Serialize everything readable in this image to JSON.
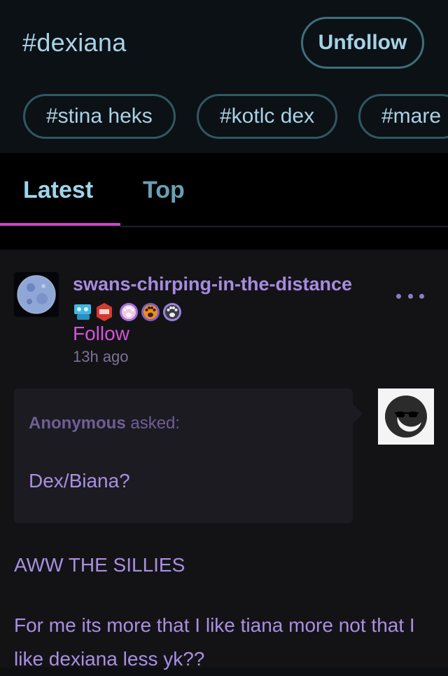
{
  "header": {
    "tag_title": "#dexiana",
    "unfollow_label": "Unfollow",
    "related_tags": [
      "#stina heks",
      "#kotlc dex",
      "#mare"
    ]
  },
  "tabs": [
    {
      "label": "Latest",
      "active": true
    },
    {
      "label": "Top",
      "active": false
    }
  ],
  "post": {
    "blog_name": "swans-chirping-in-the-distance",
    "badges": [
      "film-reel-badge",
      "red-hexagon-badge",
      "pink-paw-badge",
      "orange-paw-badge",
      "gray-paw-badge"
    ],
    "follow_label": "Follow",
    "timestamp": "13h ago",
    "ask": {
      "asker": "Anonymous",
      "asked_label": "asked:",
      "question": "Dex/Biana?"
    },
    "answer": [
      "AWW THE SILLIES",
      "For me its more that I like tiana more not that I like dexiana less yk??"
    ]
  },
  "colors": {
    "header_bg": "#0c1116",
    "tag_text": "#a9d2e6",
    "accent_underline": "#cc45c8",
    "blog_name": "#a78be0",
    "follow": "#d154d9",
    "post_text": "#a98fe2"
  }
}
